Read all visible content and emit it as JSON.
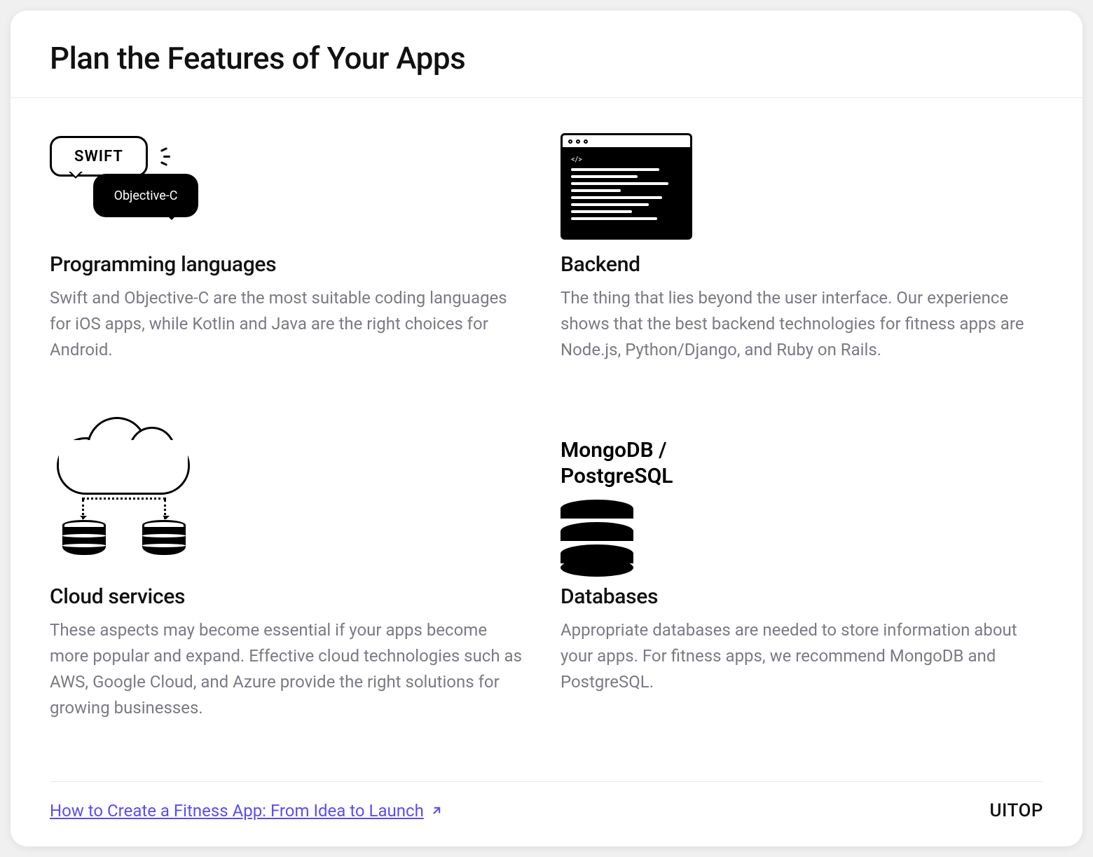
{
  "header": {
    "title": "Plan the Features of Your Apps"
  },
  "features": {
    "programming": {
      "title": "Programming languages",
      "desc": "Swift and Objective-C are the most suitable coding languages for iOS apps, while Kotlin and Java are the right choices for Android.",
      "bubble1": "SWIFT",
      "bubble2": "Objective-C"
    },
    "backend": {
      "title": "Backend",
      "desc": "The thing that lies beyond the user interface. Our experience shows that the best backend technologies for fitness apps are Node.js, Python/Django, and Ruby on Rails.",
      "code_tag": "</>"
    },
    "cloud": {
      "title": "Cloud services",
      "desc": "These aspects may become essential if your apps become more popular and expand. Effective cloud technologies such as AWS, Google Cloud, and Azure provide the right solutions for growing businesses."
    },
    "databases": {
      "icon_label": "MongoDB / PostgreSQL",
      "title": "Databases",
      "desc": "Appropriate databases are needed to store information about your apps. For fitness apps, we recommend MongoDB and PostgreSQL."
    }
  },
  "footer": {
    "link_text": "How to Create a Fitness App: From Idea to Launch",
    "brand": "UITOP"
  }
}
